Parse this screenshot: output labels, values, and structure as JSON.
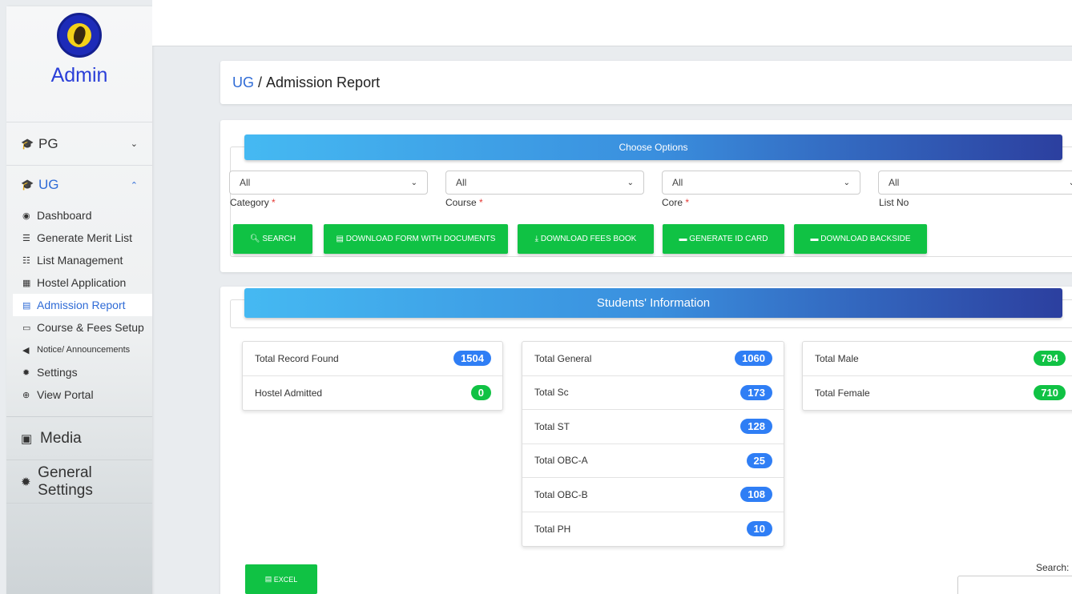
{
  "sidebar": {
    "title": "Admin",
    "pg": {
      "label": "PG",
      "icon": "graduation-cap-icon"
    },
    "ug": {
      "label": "UG",
      "icon": "graduation-cap-icon"
    },
    "items": [
      {
        "label": "Dashboard",
        "icon": "tachometer-icon"
      },
      {
        "label": "Generate Merit List",
        "icon": "list-icon"
      },
      {
        "label": "List Management",
        "icon": "ordered-list-icon"
      },
      {
        "label": "Hostel Application",
        "icon": "building-icon"
      },
      {
        "label": "Admission Report",
        "icon": "file-icon"
      },
      {
        "label": "Course & Fees Setup",
        "icon": "money-icon"
      },
      {
        "label": "Notice/ Announcements",
        "icon": "bullhorn-icon"
      },
      {
        "label": "Settings",
        "icon": "gear-icon"
      },
      {
        "label": "View Portal",
        "icon": "globe-icon"
      }
    ],
    "media": {
      "label": "Media",
      "icon": "images-icon"
    },
    "general": {
      "label": "General Settings",
      "icon": "gear-icon"
    }
  },
  "breadcrumb": {
    "link": "UG",
    "sep": " / ",
    "current": "Admission Report"
  },
  "options": {
    "banner": "Choose Options",
    "selects": [
      {
        "value": "All",
        "label": "Category",
        "required": "*"
      },
      {
        "value": "All",
        "label": "Course",
        "required": "*"
      },
      {
        "value": "All",
        "label": "Core",
        "required": "*"
      },
      {
        "value": "All",
        "label": "List No",
        "required": ""
      }
    ],
    "buttons": [
      "SEARCH",
      "DOWNLOAD FORM WITH DOCUMENTS",
      "DOWNLOAD FEES BOOK",
      "GENERATE ID CARD",
      "DOWNLOAD BACKSIDE"
    ]
  },
  "students": {
    "banner": "Students' Information",
    "col1": [
      {
        "label": "Total Record Found",
        "value": "1504",
        "color": "blue"
      },
      {
        "label": "Hostel Admitted",
        "value": "0",
        "color": "green"
      }
    ],
    "col2": [
      {
        "label": "Total General",
        "value": "1060",
        "color": "blue"
      },
      {
        "label": "Total Sc",
        "value": "173",
        "color": "blue"
      },
      {
        "label": "Total ST",
        "value": "128",
        "color": "blue"
      },
      {
        "label": "Total OBC-A",
        "value": "25",
        "color": "blue"
      },
      {
        "label": "Total OBC-B",
        "value": "108",
        "color": "blue"
      },
      {
        "label": "Total PH",
        "value": "10",
        "color": "blue"
      }
    ],
    "col3": [
      {
        "label": "Total Male",
        "value": "794",
        "color": "green"
      },
      {
        "label": "Total Female",
        "value": "710",
        "color": "green"
      }
    ],
    "excel_label": "EXCEL",
    "search_label": "Search:"
  },
  "colors": {
    "accent": "#2f6bd6",
    "green": "#10c244",
    "pill_blue": "#2f7ef5"
  }
}
